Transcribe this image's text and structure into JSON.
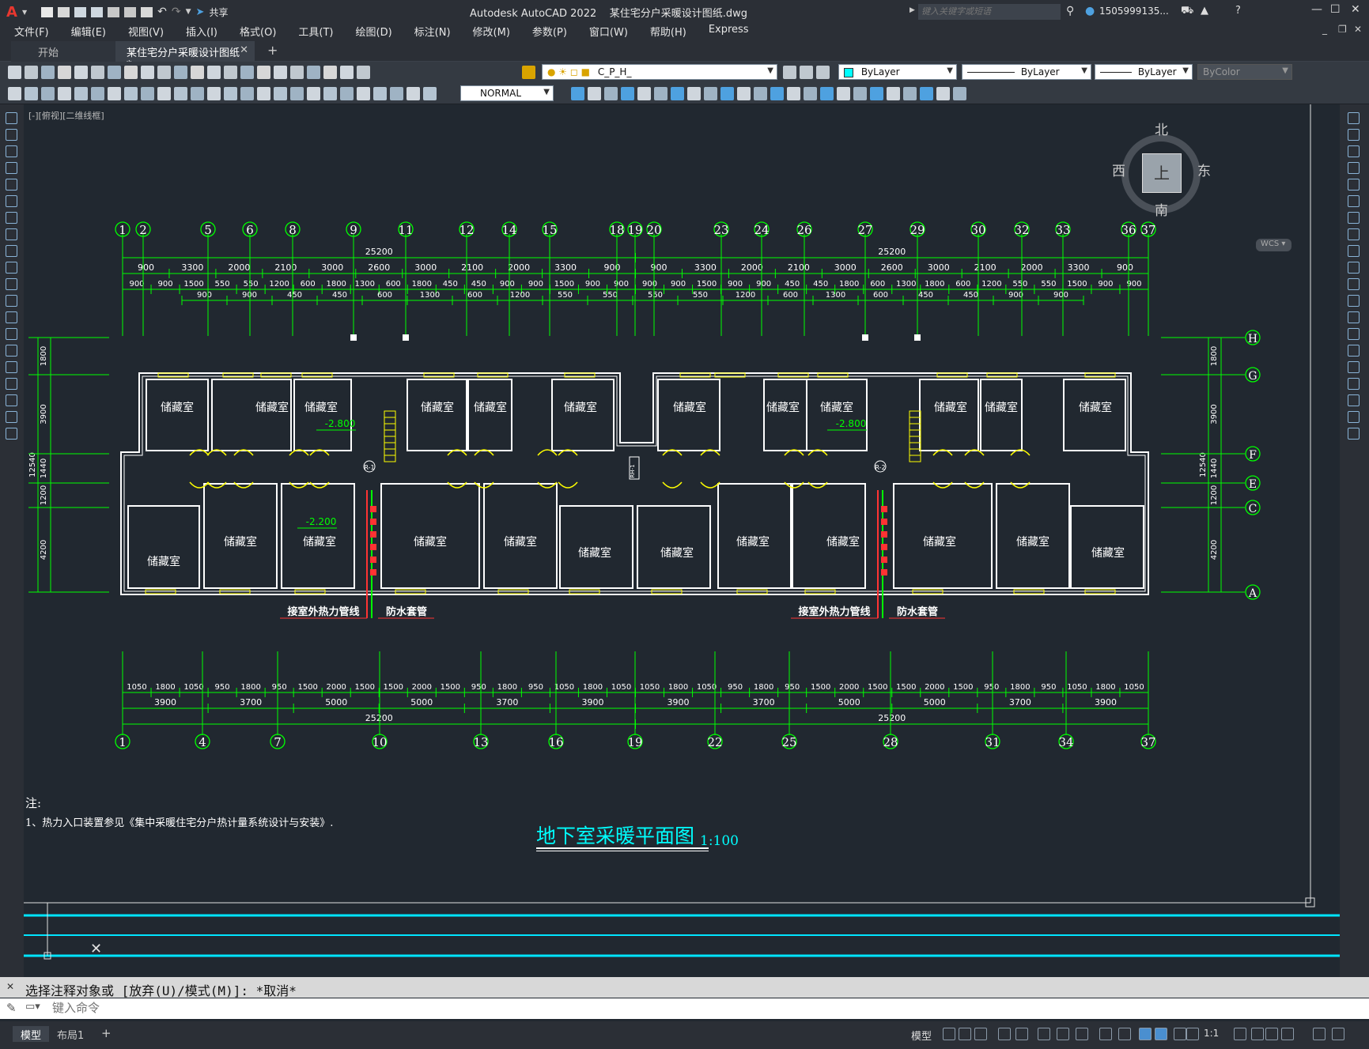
{
  "app": {
    "logo": "A",
    "title": "Autodesk AutoCAD 2022",
    "filename": "某住宅分户采暖设计图纸.dwg",
    "search_placeholder": "键入关键字或短语",
    "user": "1505999135...",
    "share_label": "共享"
  },
  "menu": [
    "文件(F)",
    "编辑(E)",
    "视图(V)",
    "插入(I)",
    "格式(O)",
    "工具(T)",
    "绘图(D)",
    "标注(N)",
    "修改(M)",
    "参数(P)",
    "窗口(W)",
    "帮助(H)",
    "Express"
  ],
  "tabs": {
    "start": "开始",
    "active": "某住宅分户采暖设计图纸*",
    "add": "+"
  },
  "toolbar": {
    "layer": "C_P_H_",
    "color": "ByLayer",
    "linetype": "ByLayer",
    "lineweight": "ByLayer",
    "plotstyle": "ByColor",
    "dimstyle": "NORMAL"
  },
  "viewport": {
    "label": "[-][俯视][二维线框]",
    "wcs": "WCS"
  },
  "viewcube": {
    "north": "北",
    "south": "南",
    "east": "东",
    "west": "西",
    "face": "上"
  },
  "drawing": {
    "title": "地下室采暖平面图",
    "scale": "1:100",
    "note_heading": "注:",
    "note_1": "1、热力入口装置参见《集中采暖住宅分户热计量系统设计与安装》.",
    "room_label": "储藏室",
    "level_1": "-2.800",
    "level_2": "-2.200",
    "pipe_label": "接室外热力管线",
    "sleeve_label": "防水套管",
    "riser_1": "R-1",
    "riser_2": "R-2",
    "riser_mid": "RH-1",
    "top_axes": [
      "1",
      "2",
      "5",
      "6",
      "8",
      "9",
      "11",
      "12",
      "14",
      "15",
      "18",
      "19",
      "20",
      "23",
      "24",
      "26",
      "27",
      "29",
      "30",
      "32",
      "33",
      "36",
      "37"
    ],
    "bottom_axes": [
      "1",
      "4",
      "7",
      "10",
      "13",
      "16",
      "19",
      "22",
      "25",
      "28",
      "31",
      "34",
      "37"
    ],
    "right_axes": [
      "H",
      "G",
      "F",
      "E",
      "C",
      "A"
    ],
    "top_total": [
      "25200",
      "25200"
    ],
    "top_row1": [
      "900",
      "3300",
      "2000",
      "2100",
      "3000",
      "2600",
      "3000",
      "2100",
      "2000",
      "3300",
      "900",
      "900",
      "3300",
      "2000",
      "2100",
      "3000",
      "2600",
      "3000",
      "2100",
      "2000",
      "3300",
      "900"
    ],
    "top_row2": [
      "900",
      "900",
      "1500",
      "550",
      "550",
      "1200",
      "600",
      "1800",
      "1300",
      "600",
      "1800",
      "450",
      "450",
      "900",
      "900",
      "1500",
      "900",
      "900",
      "900",
      "900",
      "1500",
      "900",
      "900",
      "450",
      "450",
      "1800",
      "600",
      "1300",
      "1800",
      "600",
      "1200",
      "550",
      "550",
      "1500",
      "900",
      "900"
    ],
    "top_row3": [
      "900",
      "900",
      "450",
      "450",
      "600",
      "1300",
      "600",
      "1200",
      "550",
      "550",
      "550",
      "550",
      "1200",
      "600",
      "1300",
      "600",
      "450",
      "450",
      "900",
      "900"
    ],
    "bottom_row1": [
      "1050",
      "1800",
      "1050",
      "950",
      "1800",
      "950",
      "1500",
      "2000",
      "1500",
      "1500",
      "2000",
      "1500",
      "950",
      "1800",
      "950",
      "1050",
      "1800",
      "1050",
      "1050",
      "1800",
      "1050",
      "950",
      "1800",
      "950",
      "1500",
      "2000",
      "1500",
      "1500",
      "2000",
      "1500",
      "950",
      "1800",
      "950",
      "1050",
      "1800",
      "1050"
    ],
    "bottom_row2": [
      "3900",
      "3700",
      "5000",
      "5000",
      "3700",
      "3900",
      "3900",
      "3700",
      "5000",
      "5000",
      "3700",
      "3900"
    ],
    "bottom_total": [
      "25200",
      "25200"
    ],
    "left_dims": [
      "1800",
      "3900",
      "1440",
      "1200",
      "4200"
    ],
    "left_total": "12540",
    "right_dims": [
      "1800",
      "3900",
      "1440",
      "1200",
      "4200"
    ],
    "right_total": "12540"
  },
  "command": {
    "history": "选择注释对象或 [放弃(U)/模式(M)]: *取消*",
    "placeholder": "键入命令"
  },
  "status": {
    "model_tab": "模型",
    "layout_tab": "布局1",
    "add": "+",
    "model_btn": "模型",
    "scale": "1:1"
  }
}
